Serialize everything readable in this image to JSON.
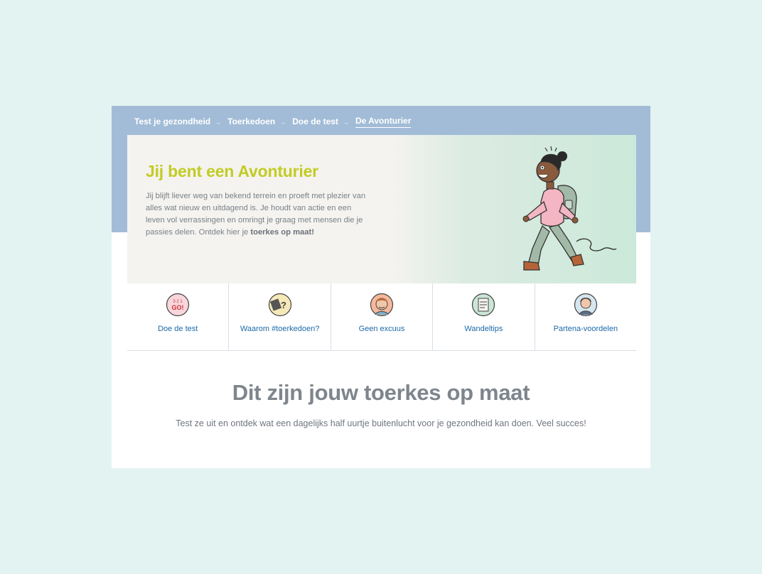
{
  "breadcrumb": {
    "items": [
      {
        "label": "Test je gezondheid"
      },
      {
        "label": "Toerkedoen"
      },
      {
        "label": "Doe de test"
      },
      {
        "label": "De Avonturier"
      }
    ],
    "separator": "→"
  },
  "hero": {
    "title": "Jij bent een Avonturier",
    "text": "Jij blijft liever weg van bekend terrein en proeft met plezier van alles wat nieuw en uitdagend is. Je houdt van actie en een leven vol verrassingen en omringt je graag met mensen die je passies delen. Ontdek hier je ",
    "text_bold": "toerkes op maat!",
    "illustration": "walking-hiker-illustration"
  },
  "tiles": [
    {
      "label": "Doe de test",
      "icon": "go-icon"
    },
    {
      "label": "Waarom #toerkedoen?",
      "icon": "question-sign-icon"
    },
    {
      "label": "Geen excuus",
      "icon": "person-face-icon"
    },
    {
      "label": "Wandeltips",
      "icon": "tips-board-icon"
    },
    {
      "label": "Partena-voordelen",
      "icon": "advisor-headset-icon"
    }
  ],
  "section": {
    "title": "Dit zijn jouw toerkes op maat",
    "subtitle": "Test ze uit en ontdek wat een dagelijks half uurtje buitenlucht voor je gezondheid kan doen. Veel succes!"
  },
  "colors": {
    "page_bg": "#e3f3f2",
    "header_band": "#a2bcd7",
    "hero_title": "#c3cb24",
    "link_blue": "#1d6aa9"
  }
}
